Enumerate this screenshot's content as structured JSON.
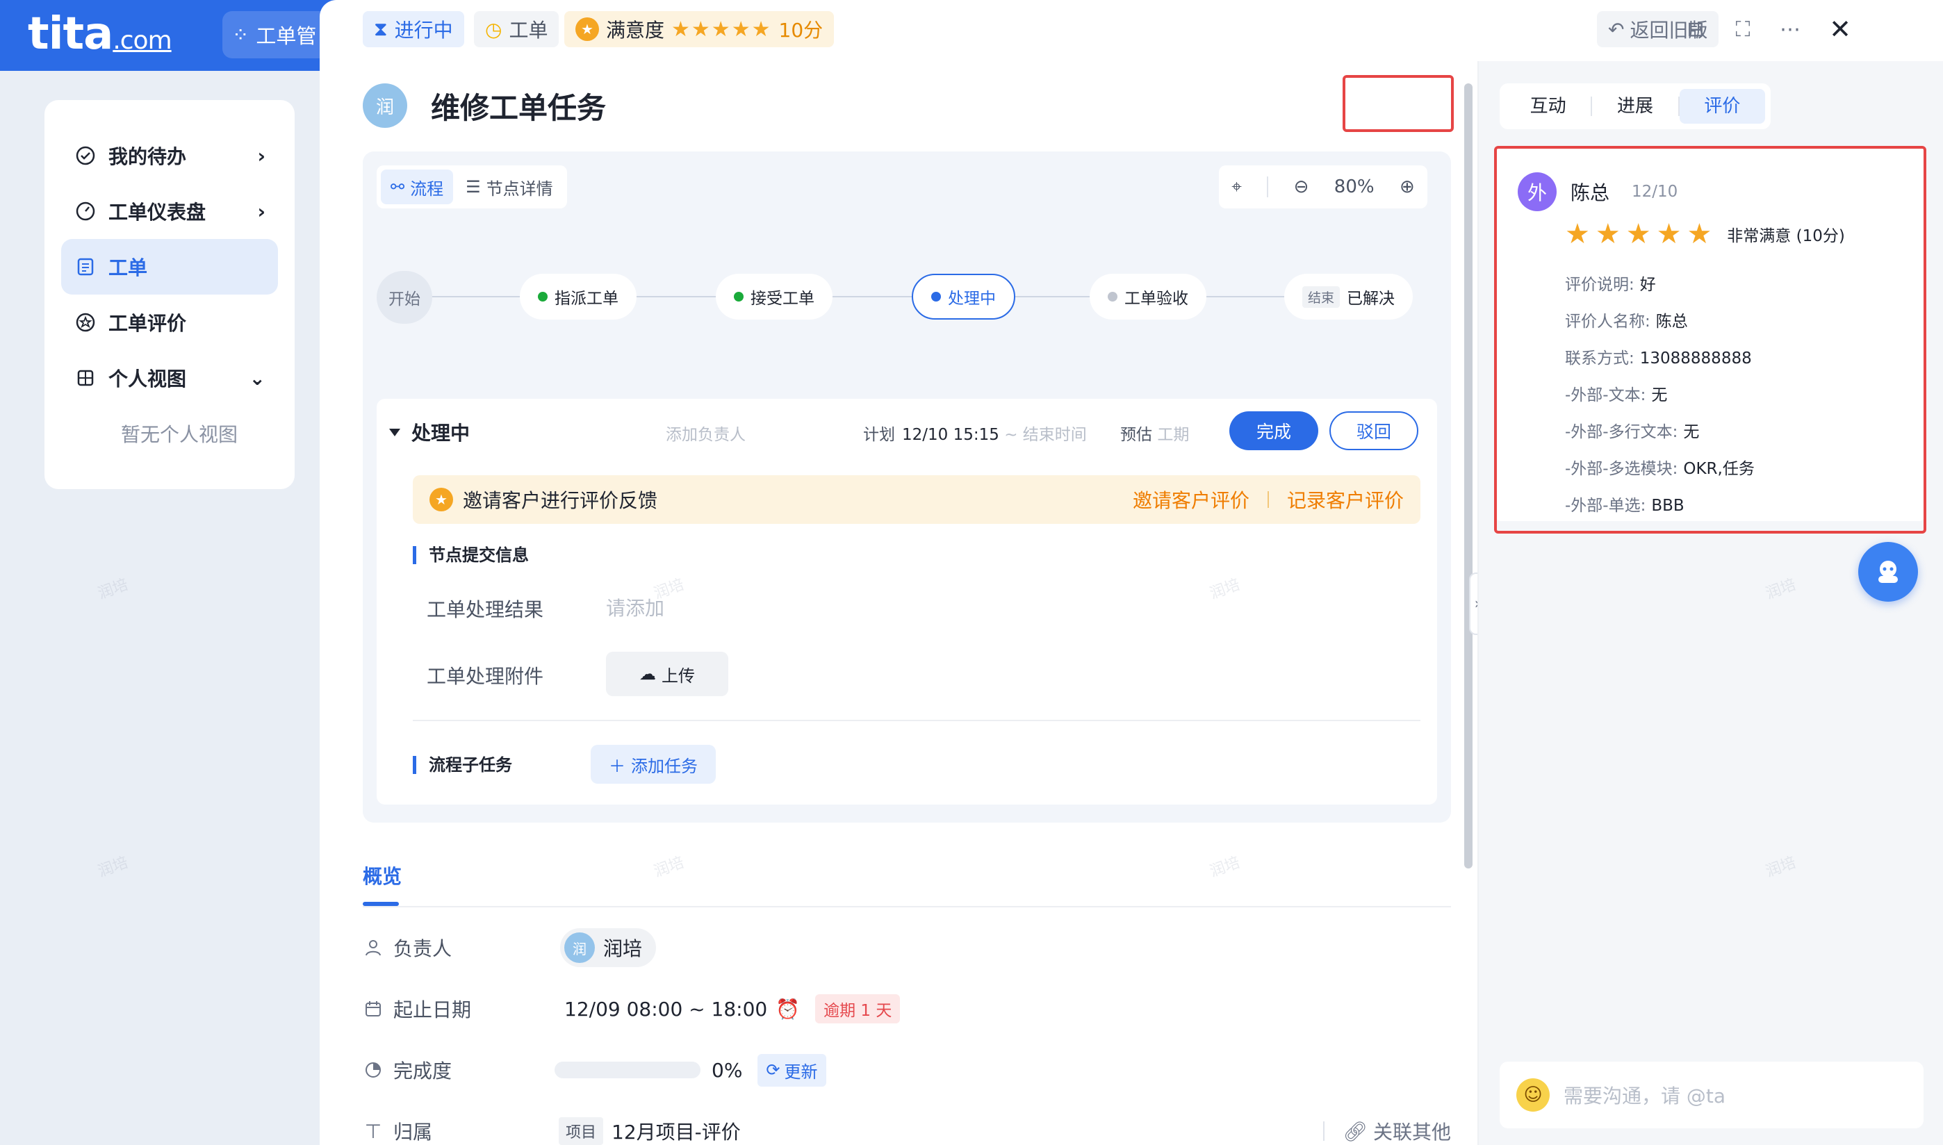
{
  "app": {
    "logo": "tita",
    "logo_suffix": ".com",
    "tab_label": "工单管"
  },
  "sidebar": {
    "items": [
      {
        "label": "我的待办",
        "icon": "check-circle-icon",
        "arrow": "chevron-right-icon"
      },
      {
        "label": "工单仪表盘",
        "icon": "gauge-icon",
        "arrow": "chevron-right-icon"
      },
      {
        "label": "工单",
        "icon": "document-icon",
        "active": true
      },
      {
        "label": "工单评价",
        "icon": "star-badge-icon"
      },
      {
        "label": "个人视图",
        "icon": "grid-icon",
        "arrow": "chevron-down-icon"
      }
    ],
    "empty_text": "暂无个人视图"
  },
  "topbar": {
    "status": "进行中",
    "type": "工单",
    "rating_label": "满意度",
    "rating_stars": 5,
    "rating_score": "10分",
    "old_version": "返回旧版"
  },
  "task": {
    "avatar": "润",
    "title": "维修工单任务"
  },
  "flow": {
    "tabs": [
      "流程",
      "节点详情"
    ],
    "zoom": "80%",
    "nodes": [
      {
        "label": "开始",
        "state": "start"
      },
      {
        "label": "指派工单",
        "state": "done",
        "color": "#1aaa3a"
      },
      {
        "label": "接受工单",
        "state": "done",
        "color": "#1aaa3a"
      },
      {
        "label": "处理中",
        "state": "current",
        "color": "#2b6be6"
      },
      {
        "label": "工单验收",
        "state": "pending",
        "color": "#c0c5cf"
      },
      {
        "label": "已解决",
        "tag": "结束",
        "state": "end"
      }
    ]
  },
  "detail": {
    "title": "处理中",
    "add_owner": "添加负责人",
    "plan_label": "计划",
    "plan_start": "12/10 15:15",
    "plan_end": "~ 结束时间",
    "estimate_label": "预估",
    "estimate_ph": "工期",
    "done_button": "完成",
    "reject_button": "驳回",
    "invite_text": "邀请客户进行评价反馈",
    "invite_link": "邀请客户评价",
    "record_link": "记录客户评价",
    "submit_section": "节点提交信息",
    "result_label": "工单处理结果",
    "result_placeholder": "请添加",
    "attachment_label": "工单处理附件",
    "upload_button": "上传",
    "subtask_section": "流程子任务",
    "add_task_button": "添加任务"
  },
  "overview": {
    "tab": "概览",
    "owner_label": "负责人",
    "owner_avatar": "润",
    "owner_name": "润培",
    "date_label": "起止日期",
    "date_value": "12/09 08:00 ~ 18:00",
    "overdue": "逾期 1 天",
    "progress_label": "完成度",
    "progress_percent": 0,
    "progress_value": "0%",
    "refresh": "更新",
    "belong_label": "归属",
    "project_tag": "项目",
    "project_name": "12月项目-评价",
    "link_other": "关联其他"
  },
  "right": {
    "tabs": [
      "互动",
      "进展",
      "评价"
    ],
    "active_tab": "评价",
    "review": {
      "avatar": "外",
      "name": "陈总",
      "date": "12/10",
      "stars": 5,
      "rating_text": "非常满意 (10分)",
      "rows": [
        {
          "label": "评价说明:",
          "value": "好"
        },
        {
          "label": "评价人名称:",
          "value": "陈总"
        },
        {
          "label": "联系方式:",
          "value": "13088888888"
        },
        {
          "label": "-外部-文本:",
          "value": "无"
        },
        {
          "label": "-外部-多行文本:",
          "value": "无"
        },
        {
          "label": "-外部-多选模块:",
          "value": "OKR,任务"
        },
        {
          "label": "-外部-单选:",
          "value": "BBB"
        }
      ]
    },
    "chat_placeholder": "需要沟通，请 @ta"
  },
  "colors": {
    "primary": "#2b6be6",
    "highlight": "#e64545",
    "star": "#f5a623",
    "warning": "#ef7d00"
  },
  "watermark": "润培"
}
